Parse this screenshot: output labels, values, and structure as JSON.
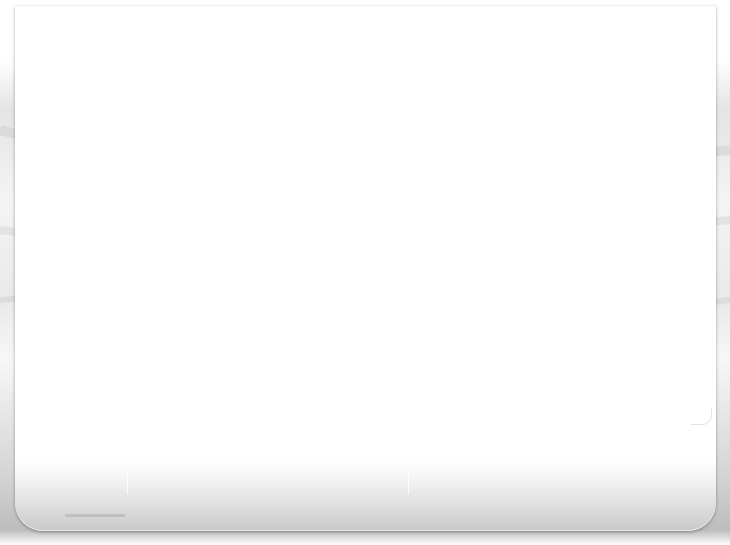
{
  "window": {
    "title": ""
  },
  "colors": {
    "panel": "#ffffff",
    "backdrop": "#e6e6e6",
    "footer_shade": "#c9c9c9"
  }
}
